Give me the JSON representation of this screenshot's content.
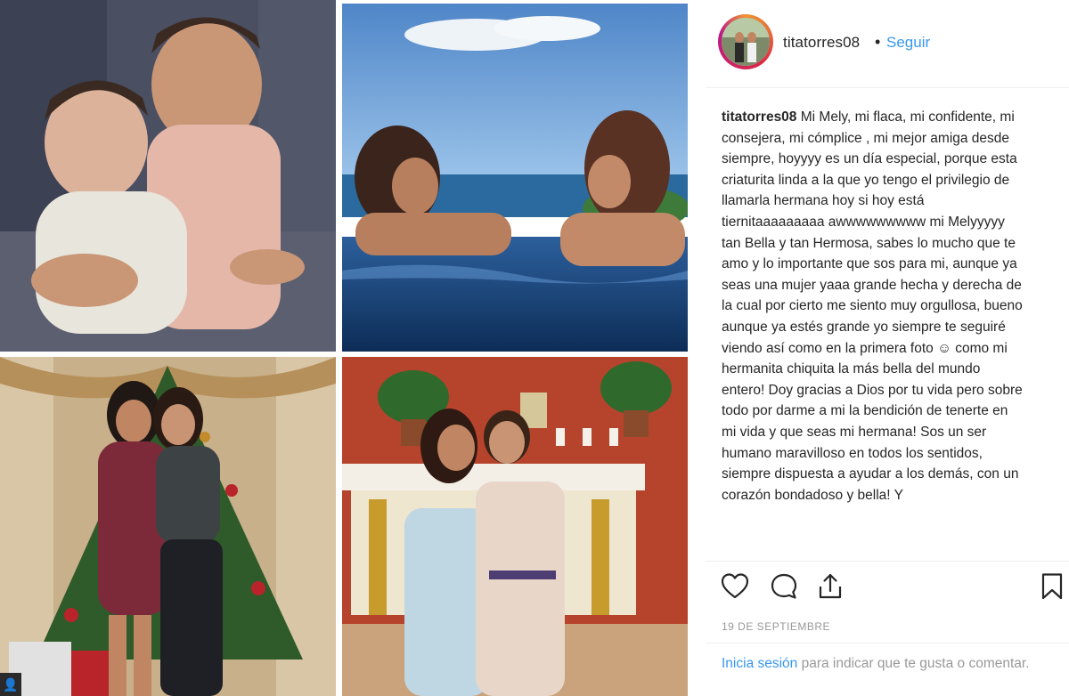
{
  "post": {
    "photos": [
      {
        "description_icon": "photo-baby-siblings-icon"
      },
      {
        "description_icon": "photo-pool-icon"
      },
      {
        "description_icon": "photo-christmas-tree-icon"
      },
      {
        "description_icon": "photo-church-icon"
      }
    ]
  },
  "header": {
    "username": "titatorres08",
    "separator": "•",
    "follow_label": "Seguir"
  },
  "caption": {
    "username": "titatorres08",
    "text": "Mi Mely, mi flaca, mi confidente, mi consejera, mi cómplice , mi mejor amiga desde siempre, hoyyyy es un día especial, porque esta criaturita linda a la que yo tengo el privilegio de llamarla hermana hoy si hoy está tiernitaaaaaaaaa awwwwwwwww mi Melyyyyy tan Bella y tan Hermosa, sabes lo mucho que te amo y lo importante que sos para mi, aunque ya seas una mujer yaaa grande hecha y derecha de la cual por cierto me siento muy orgullosa, bueno aunque ya estés grande yo siempre te seguiré viendo así como en la primera foto ☺ como mi hermanita chiquita la más bella del mundo entero! Doy gracias a Dios por tu vida pero sobre todo por darme a mi la bendición de tenerte en mi vida y que seas mi hermana! Sos un ser humano maravilloso en todos los sentidos, siempre dispuesta a ayudar a los demás, con un corazón bondadoso y bella! Y"
  },
  "actions": {
    "like_icon": "heart-icon",
    "comment_icon": "comment-icon",
    "share_icon": "share-icon",
    "save_icon": "bookmark-icon"
  },
  "date": "19 DE SEPTIEMBRE",
  "login": {
    "link_text": "Inicia sesión",
    "rest_text": " para indicar que te gusta o comentar."
  },
  "colors": {
    "link_blue": "#3897f0",
    "text_dark": "#262626",
    "text_muted": "#999999"
  }
}
